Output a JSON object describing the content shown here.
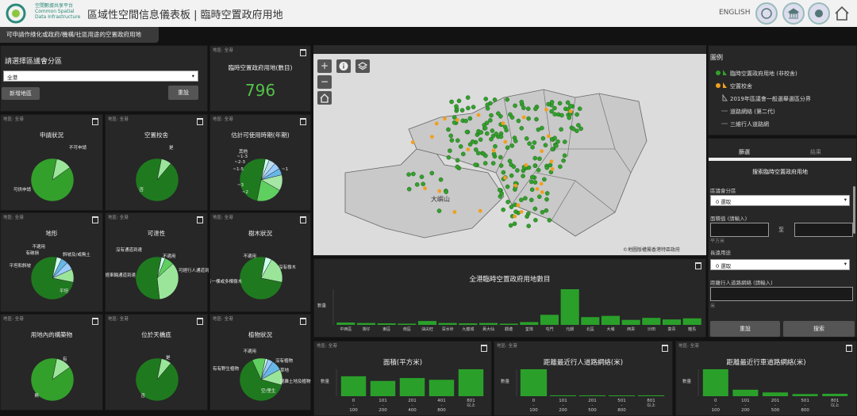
{
  "header": {
    "logo_text": [
      "空間數據共享平台",
      "Common Spatial",
      "Data Infrastructure"
    ],
    "title": "區域性空間信息儀表板 | 臨時空置政府用地",
    "lang": "ENGLISH"
  },
  "banner": "可申請作綠化或政府/機構/社區用途的空置政府用地",
  "selector": {
    "title": "請選擇區議會分區",
    "value": "全港",
    "add_label": "新增地區",
    "reset_label": "重設"
  },
  "kpi": {
    "title": "臨時空置政府用地(數目)",
    "value": "796"
  },
  "region_label": "地區: 全港",
  "pies": [
    {
      "key": "p1",
      "title": "申請狀況",
      "labels": [
        "不可申請",
        "可供申請"
      ]
    },
    {
      "key": "p2",
      "title": "空置校舍",
      "labels": [
        "是",
        "否"
      ]
    },
    {
      "key": "p3",
      "title": "估計可使用時期(年期)",
      "labels": [
        "其他",
        "~1-3",
        "~2-3",
        "~1-5",
        "~3",
        "~2",
        "~1"
      ]
    },
    {
      "key": "p4",
      "title": "地形",
      "labels": [
        "不適用",
        "有破損",
        "斜坡及/或無土",
        "平坦和斜坡",
        "平坦"
      ]
    },
    {
      "key": "p5",
      "title": "可達性",
      "labels": [
        "不適用",
        "沒有通道到達",
        "可經車輛通道到達",
        "可經行人通道到達"
      ]
    },
    {
      "key": "p6",
      "title": "樹木狀況",
      "labels": [
        "不適用",
        "沒有樹木",
        "有一棵或多棵樹木"
      ]
    },
    {
      "key": "p7",
      "title": "用地內的構築物",
      "labels": [
        "有",
        "無"
      ]
    },
    {
      "key": "p8",
      "title": "位於天橋底",
      "labels": [
        "是",
        "否"
      ]
    },
    {
      "key": "p9",
      "title": "植物狀況",
      "labels": [
        "不適用",
        "沒有植物",
        "草地",
        "混雜土地及植物",
        "有有野生植物",
        "空/里生"
      ]
    }
  ],
  "map": {
    "place_label": "大嶼山",
    "attribution": "©地圖版權屬香港特區政府"
  },
  "legend": {
    "title": "圖例",
    "items": [
      "臨時空置政府用地 (非校舍)",
      "空置校舍",
      "2019年區議會一般選舉選區分界",
      "道路網絡 (第二代)",
      "三維行人道路網"
    ]
  },
  "filter": {
    "tabs": [
      "篩選",
      "結果"
    ],
    "heading": "搜索臨時空置政府用地",
    "district_label": "區議會分區",
    "district_value": "0 選取",
    "area_label": "面積值 (請輸入)",
    "area_to": "至",
    "area_unit": "平方米",
    "use_label": "長遠用途",
    "use_value": "0 選取",
    "dist_label": "距離行人道路網絡 (請輸入)",
    "dist_unit": "米",
    "reset_label": "重設",
    "search_label": "搜索"
  },
  "charts": {
    "district": {
      "title": "全港臨時空置政府用地數目",
      "ylabel": "數量"
    },
    "area": {
      "title": "面積(平方米)",
      "ylabel": "數量"
    },
    "ped": {
      "title": "距離最近行人道路網絡(米)",
      "ylabel": "數量"
    },
    "road": {
      "title": "距離最近行車道路網絡(米)",
      "ylabel": "數量"
    }
  },
  "chart_data": [
    {
      "type": "bar",
      "title": "全港臨時空置政府用地數目",
      "ylabel": "數量",
      "categories": [
        "中西區",
        "灣仔",
        "東區",
        "南區",
        "油尖旺",
        "深水埗",
        "九龍城",
        "黃大仙",
        "觀塘",
        "荃灣",
        "屯門",
        "元朗",
        "北區",
        "大埔",
        "西貢",
        "沙田",
        "葵青",
        "離島"
      ],
      "values": [
        15,
        12,
        10,
        8,
        25,
        12,
        10,
        12,
        8,
        18,
        65,
        230,
        50,
        58,
        32,
        45,
        35,
        42
      ]
    },
    {
      "type": "bar",
      "title": "面積(平方米)",
      "ylabel": "數量",
      "categories": [
        "0 - 100",
        "101 - 200",
        "201 - 400",
        "401 - 800",
        "801 以上"
      ],
      "values": [
        170,
        130,
        155,
        140,
        230
      ]
    },
    {
      "type": "bar",
      "title": "距離最近行人道路網絡(米)",
      "ylabel": "數量",
      "categories": [
        "0 - 100",
        "101 - 200",
        "201 - 500",
        "501 - 800",
        "801 以上"
      ],
      "values": [
        630,
        20,
        20,
        15,
        20
      ]
    },
    {
      "type": "bar",
      "title": "距離最近行車道路網絡(米)",
      "ylabel": "數量",
      "categories": [
        "0 - 100",
        "101 - 200",
        "201 - 500",
        "501 - 800",
        "801 以上"
      ],
      "values": [
        500,
        120,
        70,
        40,
        45
      ]
    }
  ],
  "colors": {
    "green": "#33a02c",
    "dark_green": "#1f7a1f",
    "light_green": "#9be59b",
    "orange": "#f0a020",
    "blue": "#67b7e8"
  }
}
